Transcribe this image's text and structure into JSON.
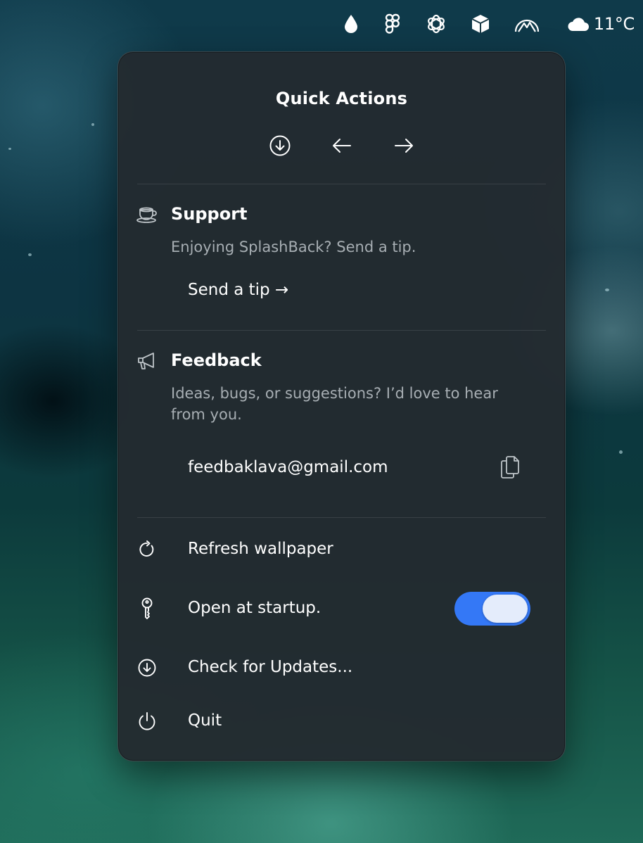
{
  "menubar": {
    "icons": [
      "raindrop-icon",
      "figma-icon",
      "openai-icon",
      "box-app-icon",
      "mountain-app-icon",
      "cloud-icon"
    ],
    "temperature": "11°C"
  },
  "panel": {
    "title": "Quick Actions",
    "nav_icons": [
      "download-circle-icon",
      "arrow-left-icon",
      "arrow-right-icon"
    ],
    "support": {
      "title": "Support",
      "description": "Enjoying SplashBack? Send a tip.",
      "link_label": "Send a tip →",
      "icon": "teacup-icon"
    },
    "feedback": {
      "title": "Feedback",
      "description": "Ideas, bugs, or suggestions? I’d love to hear from you.",
      "email": "feedbaklava@gmail.com",
      "icon": "megaphone-icon",
      "copy_icon": "copy-icon"
    },
    "menu": {
      "refresh_label": "Refresh wallpaper",
      "startup_label": "Open at startup.",
      "startup_enabled": true,
      "updates_label": "Check for Updates...",
      "quit_label": "Quit"
    }
  },
  "colors": {
    "panel_bg": "#232b30",
    "toggle_on": "#3478f6",
    "secondary_text": "#a7aeb3"
  }
}
